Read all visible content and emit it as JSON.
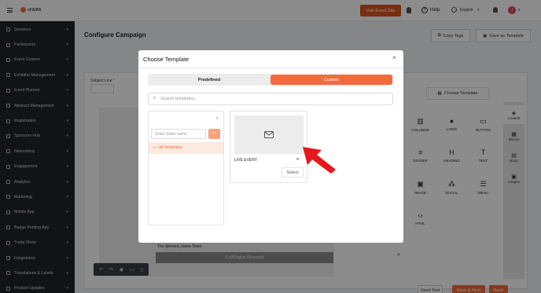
{
  "topbar": {
    "brand": "vFAIRS",
    "visit_event_label": "Visit Event Site",
    "help_label": "Help",
    "language_label": "English",
    "avatar_initial": "J"
  },
  "sidebar": {
    "items": [
      {
        "label": "Sessions",
        "icon": "grid-icon"
      },
      {
        "label": "Participants",
        "icon": "users-icon"
      },
      {
        "label": "Event Content",
        "icon": "file-icon"
      },
      {
        "label": "Exhibitor Management",
        "icon": "grid-icon"
      },
      {
        "label": "Event Planner",
        "icon": "calendar-icon"
      },
      {
        "label": "Abstract Management",
        "icon": "file-icon"
      },
      {
        "label": "Registration",
        "icon": "form-icon"
      },
      {
        "label": "Sponsors Hub",
        "icon": "star-icon"
      },
      {
        "label": "Networking",
        "icon": "network-icon"
      },
      {
        "label": "Engagement",
        "icon": "flag-icon"
      },
      {
        "label": "Analytics",
        "icon": "chart-icon"
      },
      {
        "label": "Marketing",
        "icon": "send-icon"
      },
      {
        "label": "Mobile App",
        "icon": "phone-icon"
      },
      {
        "label": "Badge Printing App",
        "icon": "badge-icon"
      },
      {
        "label": "Trade Show",
        "icon": "store-icon"
      },
      {
        "label": "Integrations",
        "icon": "plug-icon"
      },
      {
        "label": "Translations & Labels",
        "icon": "translate-icon"
      },
      {
        "label": "Product Updates",
        "icon": "bell-icon"
      }
    ]
  },
  "page": {
    "title": "Configure Campaign",
    "copy_tags_label": "Copy Tags",
    "save_as_template_label": "Save as Template",
    "subject_line_label": "Subject Line",
    "required_mark": "*",
    "choose_template_label": "Choose Template",
    "email_footer_team": "The @event_name Team",
    "email_footer_rights": "© All Rights Reserved",
    "send_test_label": "Send Test",
    "save_next_label": "Save & Next",
    "back_label": "Back"
  },
  "content_blocks": [
    {
      "label": "COLUMNS",
      "icon": "columns-icon"
    },
    {
      "label": "LOGO",
      "icon": "user-icon"
    },
    {
      "label": "BUTTON",
      "icon": "button-icon"
    },
    {
      "label": "DIVIDER",
      "icon": "divider-icon"
    },
    {
      "label": "HEADING",
      "icon": "heading-icon"
    },
    {
      "label": "TEXT",
      "icon": "text-icon"
    },
    {
      "label": "IMAGE",
      "icon": "image-icon"
    },
    {
      "label": "SOCIAL",
      "icon": "social-icon"
    },
    {
      "label": "MENU",
      "icon": "menu-icon"
    },
    {
      "label": "HTML",
      "icon": "code-icon"
    }
  ],
  "right_tabs": [
    {
      "label": "Content",
      "icon": "content-icon"
    },
    {
      "label": "Blocks",
      "icon": "blocks-icon"
    },
    {
      "label": "Body",
      "icon": "body-icon"
    },
    {
      "label": "Images",
      "icon": "images-icon"
    }
  ],
  "modal": {
    "title": "Choose Template",
    "tabs": {
      "predefined": "Predefined",
      "custom": "Custom"
    },
    "search_placeholder": "Search templates...",
    "folder_name_placeholder": "Enter folder name",
    "all_templates_label": "All Templates",
    "collapse_glyph": "‹",
    "template_card": {
      "name": "LIVE EVENT",
      "select_label": "Select",
      "menu_glyph": "•••"
    }
  },
  "colors": {
    "accent": "#f26b3a",
    "sidebar_bg": "#1f2328",
    "annotation_arrow": "#e8171c"
  }
}
